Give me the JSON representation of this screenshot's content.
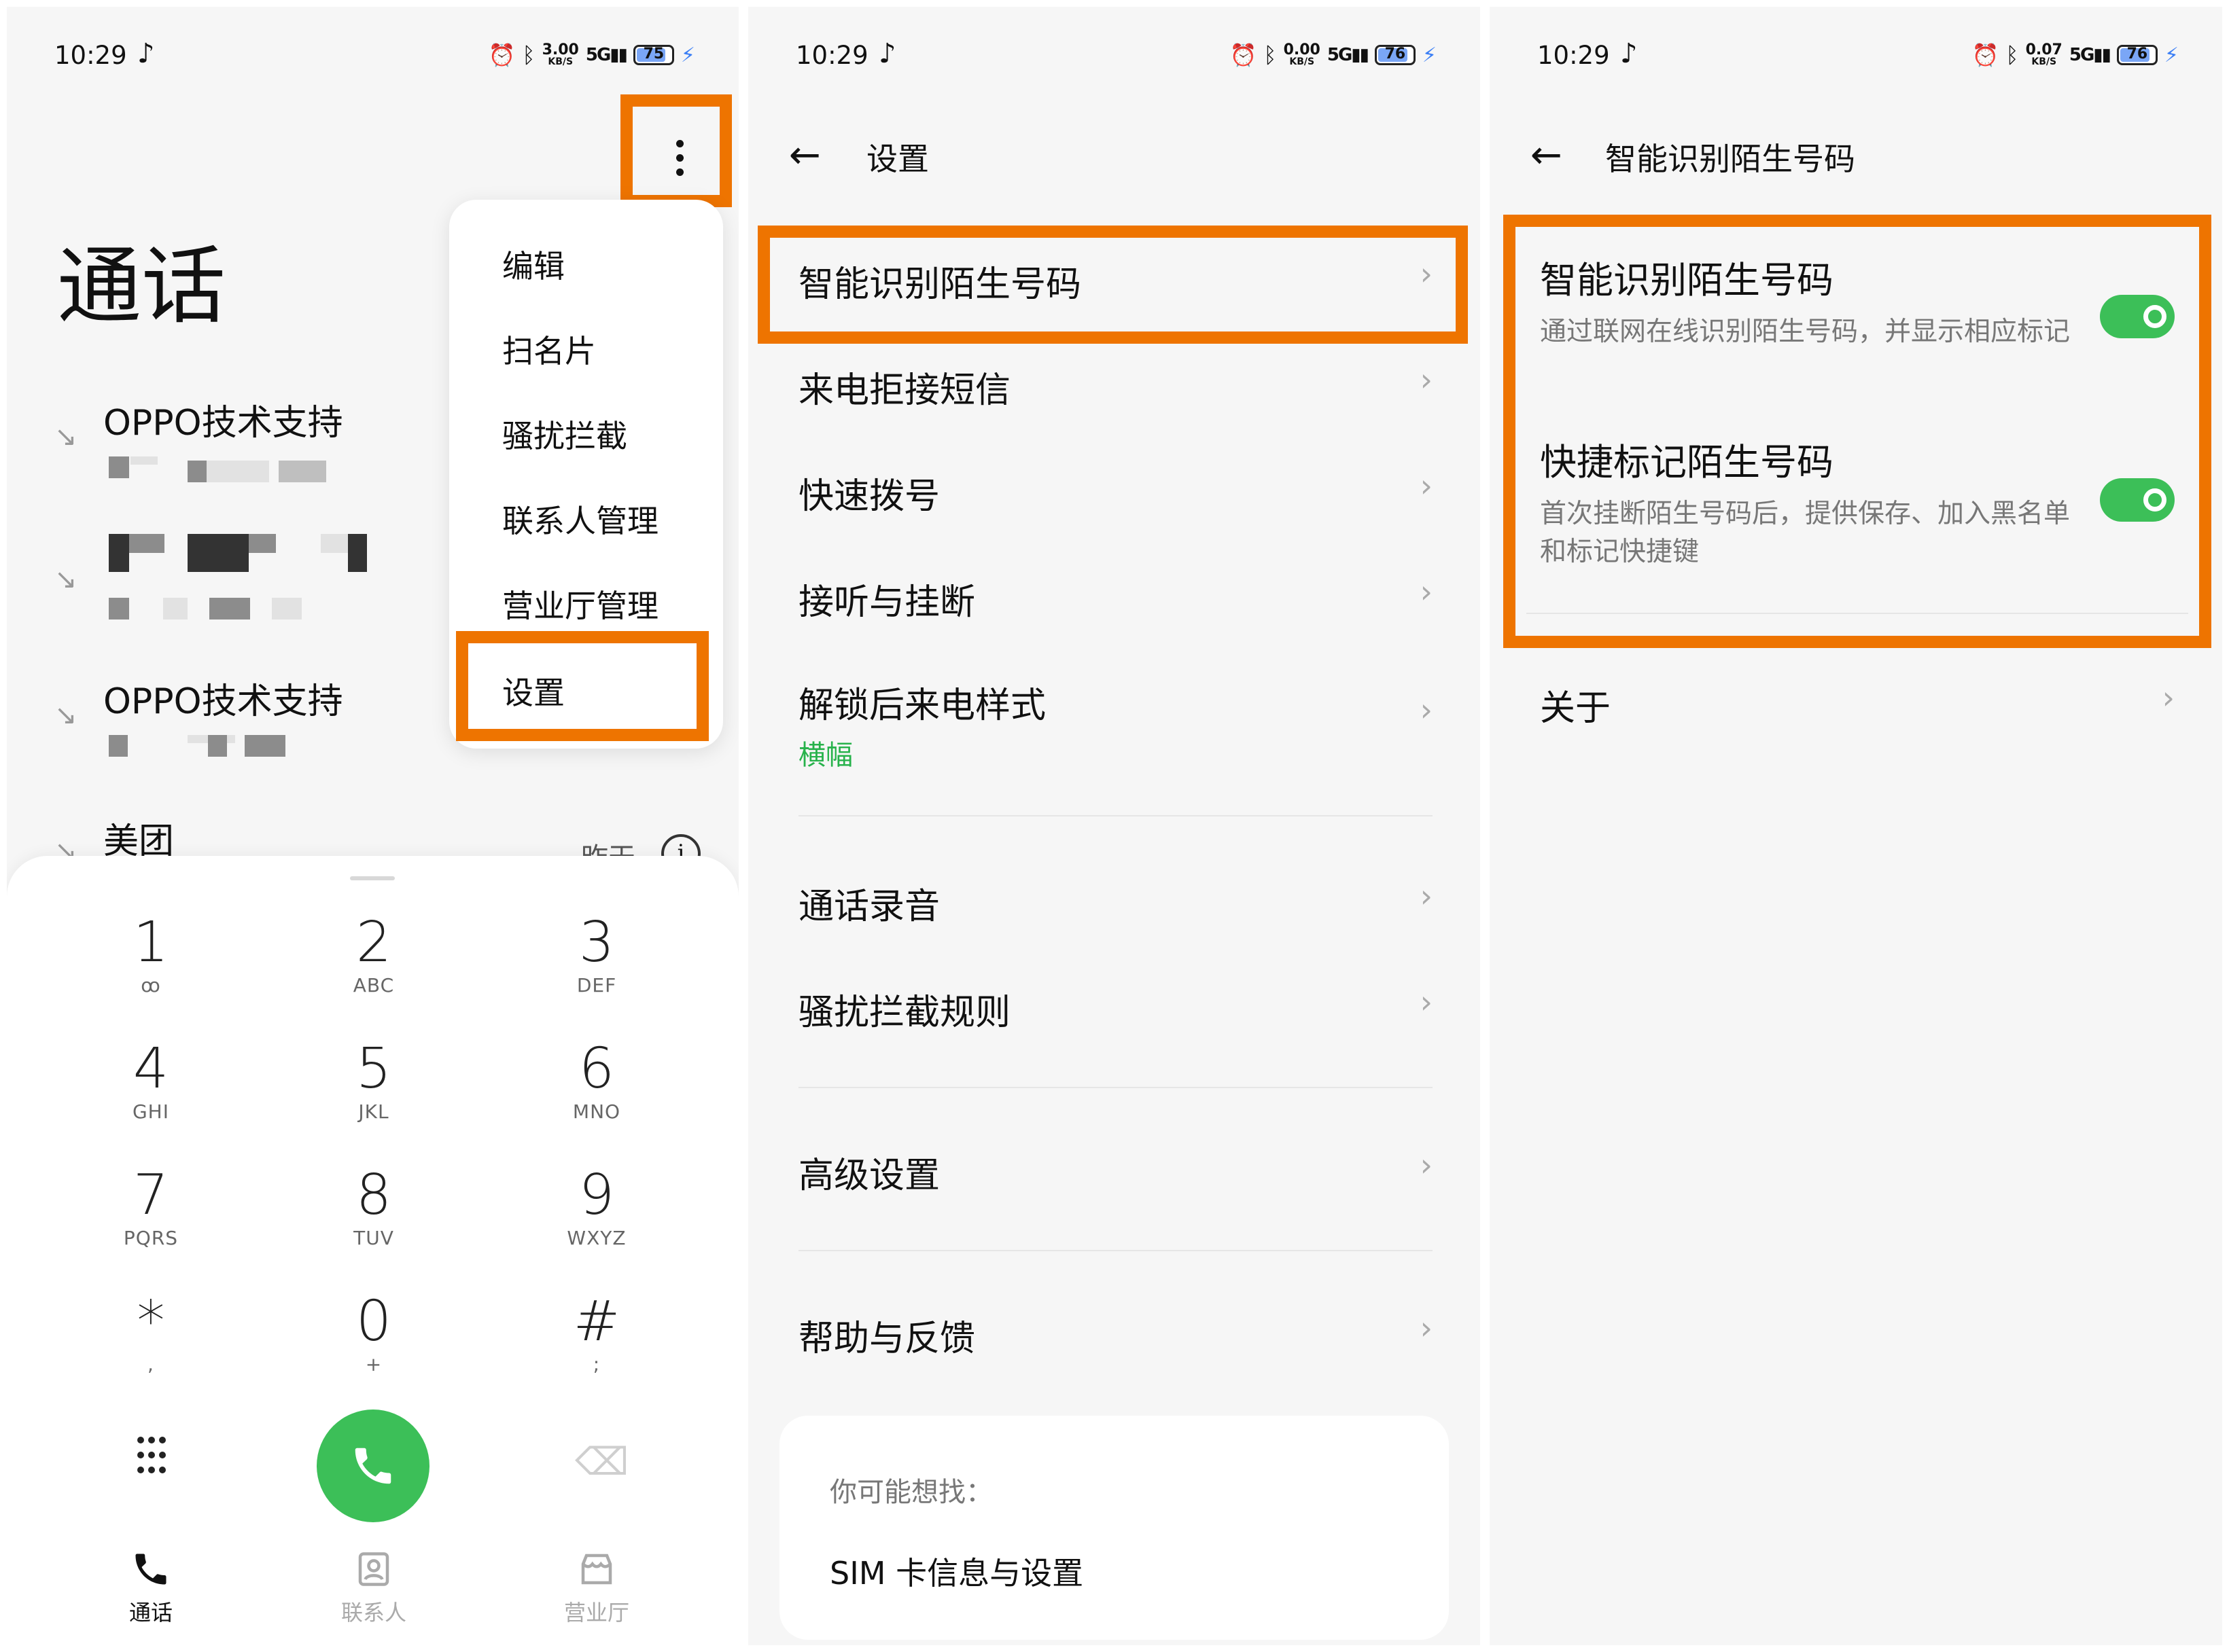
{
  "statusbar": {
    "time": "10:29",
    "panel1_speed": "3.00",
    "panel2_speed": "0.00",
    "panel3_speed": "0.07",
    "speed_unit": "KB/S",
    "net_label": "5G",
    "panel1_battery": "75",
    "panel2_battery": "76",
    "panel3_battery": "76"
  },
  "dialer": {
    "title": "通话",
    "calls": [
      {
        "name": "OPPO技术支持"
      },
      {
        "name": ""
      },
      {
        "name": "OPPO技术支持"
      },
      {
        "name": "美团",
        "time": "昨天"
      }
    ],
    "menu": [
      "编辑",
      "扫名片",
      "骚扰拦截",
      "联系人管理",
      "营业厅管理",
      "设置"
    ],
    "keys": [
      {
        "digit": "1",
        "letters": "ꝏ"
      },
      {
        "digit": "2",
        "letters": "ABC"
      },
      {
        "digit": "3",
        "letters": "DEF"
      },
      {
        "digit": "4",
        "letters": "GHI"
      },
      {
        "digit": "5",
        "letters": "JKL"
      },
      {
        "digit": "6",
        "letters": "MNO"
      },
      {
        "digit": "7",
        "letters": "PQRS"
      },
      {
        "digit": "8",
        "letters": "TUV"
      },
      {
        "digit": "9",
        "letters": "WXYZ"
      },
      {
        "digit": "*",
        "letters": ","
      },
      {
        "digit": "0",
        "letters": "+"
      },
      {
        "digit": "#",
        "letters": ";"
      }
    ],
    "nav": [
      "通话",
      "联系人",
      "营业厅"
    ]
  },
  "settings": {
    "title": "设置",
    "items": [
      {
        "label": "智能识别陌生号码"
      },
      {
        "label": "来电拒接短信"
      },
      {
        "label": "快速拨号"
      },
      {
        "label": "接听与挂断"
      },
      {
        "label": "解锁后来电样式",
        "value": "横幅"
      },
      {
        "label": "通话录音"
      },
      {
        "label": "骚扰拦截规则"
      },
      {
        "label": "高级设置"
      },
      {
        "label": "帮助与反馈"
      }
    ],
    "suggest_title": "你可能想找：",
    "suggest_item": "SIM 卡信息与设置"
  },
  "smart": {
    "title": "智能识别陌生号码",
    "items": [
      {
        "title": "智能识别陌生号码",
        "desc": "通过联网在线识别陌生号码，并显示相应标记",
        "on": true
      },
      {
        "title": "快捷标记陌生号码",
        "desc": "首次挂断陌生号码后，提供保存、加入黑名单和标记快捷键",
        "on": true
      }
    ],
    "about": "关于"
  },
  "colors": {
    "highlight": "#ee7400",
    "toggle_on": "#3cbf58",
    "accent_green": "#27b24b",
    "call_button": "#3cbf58"
  }
}
